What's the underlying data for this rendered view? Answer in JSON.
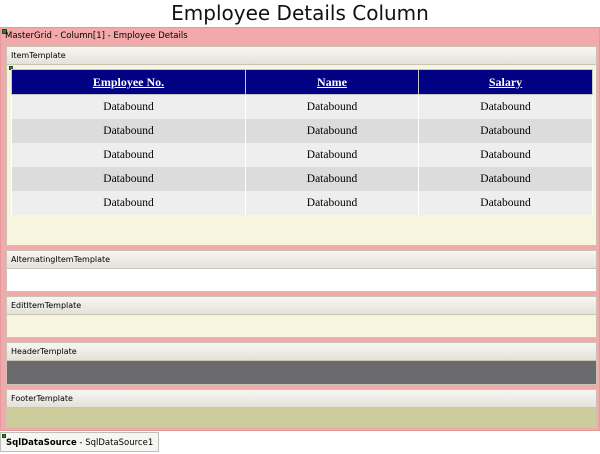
{
  "title": "Employee Details Column",
  "grid": {
    "caption": "MasterGrid - Column[1] - Employee Details",
    "templates": [
      {
        "name": "ItemTemplate",
        "body_color": "#f7f5dd"
      },
      {
        "name": "AlternatingItemTemplate",
        "body_color": "#ffffff"
      },
      {
        "name": "EditItemTemplate",
        "body_color": "#f7f5dd"
      },
      {
        "name": "HeaderTemplate",
        "body_color": "#6b6a6c"
      },
      {
        "name": "FooterTemplate",
        "body_color": "#cdcc9b"
      }
    ],
    "inner_grid": {
      "columns": [
        "Employee No.",
        "Name",
        "Salary"
      ],
      "rows": [
        [
          "Databound",
          "Databound",
          "Databound"
        ],
        [
          "Databound",
          "Databound",
          "Databound"
        ],
        [
          "Databound",
          "Databound",
          "Databound"
        ],
        [
          "Databound",
          "Databound",
          "Databound"
        ],
        [
          "Databound",
          "Databound",
          "Databound"
        ]
      ],
      "header_color": "#010183"
    }
  },
  "datasource": {
    "type": "SqlDataSource",
    "id": " - SqlDataSource1"
  },
  "colors": {
    "grid_border": "#f2a9a9"
  }
}
